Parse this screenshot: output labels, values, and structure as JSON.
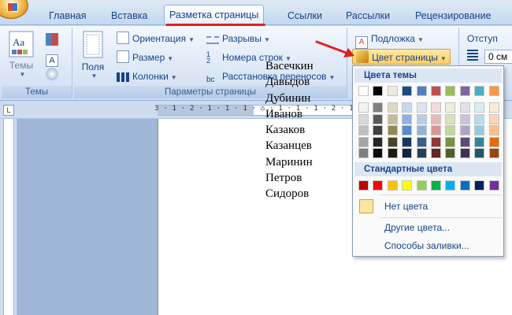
{
  "tabs": [
    {
      "label": "Главная",
      "active": false
    },
    {
      "label": "Вставка",
      "active": false
    },
    {
      "label": "Разметка страницы",
      "active": true
    },
    {
      "label": "Ссылки",
      "active": false
    },
    {
      "label": "Рассылки",
      "active": false
    },
    {
      "label": "Рецензирование",
      "active": false
    }
  ],
  "ribbon": {
    "themes": {
      "button_label": "Темы",
      "group_label": "Темы"
    },
    "page_setup": {
      "fields_label": "Поля",
      "orientation": "Ориентация",
      "size": "Размер",
      "columns": "Колонки",
      "breaks": "Разрывы",
      "line_numbers": "Номера строк",
      "hyphenation": "Расстановка переносов",
      "group_label": "Параметры страницы"
    },
    "background": {
      "watermark": "Подложка",
      "page_color": "Цвет страницы"
    },
    "paragraph": {
      "indent_label": "Отступ",
      "indent_value": "0 см"
    }
  },
  "ruler_text": "3 · 1 · 2 · 1 · 1 · 1 · ⌂ · 1 · 1 · 1 · 2 · 1 · 3 · 1 · 4 · 1 · 5",
  "document": {
    "names": [
      "Васечкин",
      "Давыдов",
      "Дубинин",
      "Иванов",
      "Казаков",
      "Казанцев",
      "Маринин",
      "Петров",
      "Сидоров"
    ]
  },
  "color_menu": {
    "theme_colors_header": "Цвета темы",
    "theme_top_row": [
      "#ffffff",
      "#000000",
      "#eeece1",
      "#1f497d",
      "#4f81bd",
      "#c0504d",
      "#9bbb59",
      "#8064a2",
      "#4bacc6",
      "#f79646"
    ],
    "theme_shades": [
      [
        "#f2f2f2",
        "#7f7f7f",
        "#ddd9c3",
        "#c6d9f0",
        "#dbe5f1",
        "#f2dcdb",
        "#ebf1dd",
        "#e5e0ec",
        "#dbeef3",
        "#fdeada"
      ],
      [
        "#d8d8d8",
        "#595959",
        "#c4bd97",
        "#8db3e2",
        "#b8cce4",
        "#e5b9b7",
        "#d7e3bc",
        "#ccc1d9",
        "#b7dde8",
        "#fbd5b5"
      ],
      [
        "#bfbfbf",
        "#3f3f3f",
        "#938953",
        "#548dd4",
        "#95b3d7",
        "#d99694",
        "#c3d69b",
        "#b2a2c7",
        "#92cddc",
        "#fac08f"
      ],
      [
        "#a5a5a5",
        "#262626",
        "#494429",
        "#17365d",
        "#366092",
        "#953734",
        "#76923c",
        "#5f497a",
        "#31859b",
        "#e36c09"
      ],
      [
        "#7f7f7f",
        "#0c0c0c",
        "#1d1b10",
        "#0f243e",
        "#244061",
        "#632423",
        "#4f6128",
        "#3f3151",
        "#205867",
        "#974806"
      ]
    ],
    "standard_colors_header": "Стандартные цвета",
    "standard_colors": [
      "#c00000",
      "#ff0000",
      "#ffc000",
      "#ffff00",
      "#92d050",
      "#00b050",
      "#00b0f0",
      "#0070c0",
      "#002060",
      "#7030a0"
    ],
    "no_color": "Нет цвета",
    "no_color_swatch": "#fbe6a2",
    "more_colors": "Другие цвета...",
    "fill_effects": "Способы заливки..."
  },
  "colors": {
    "annotation_red": "#e02020",
    "ribbon_text": "#15428b"
  }
}
